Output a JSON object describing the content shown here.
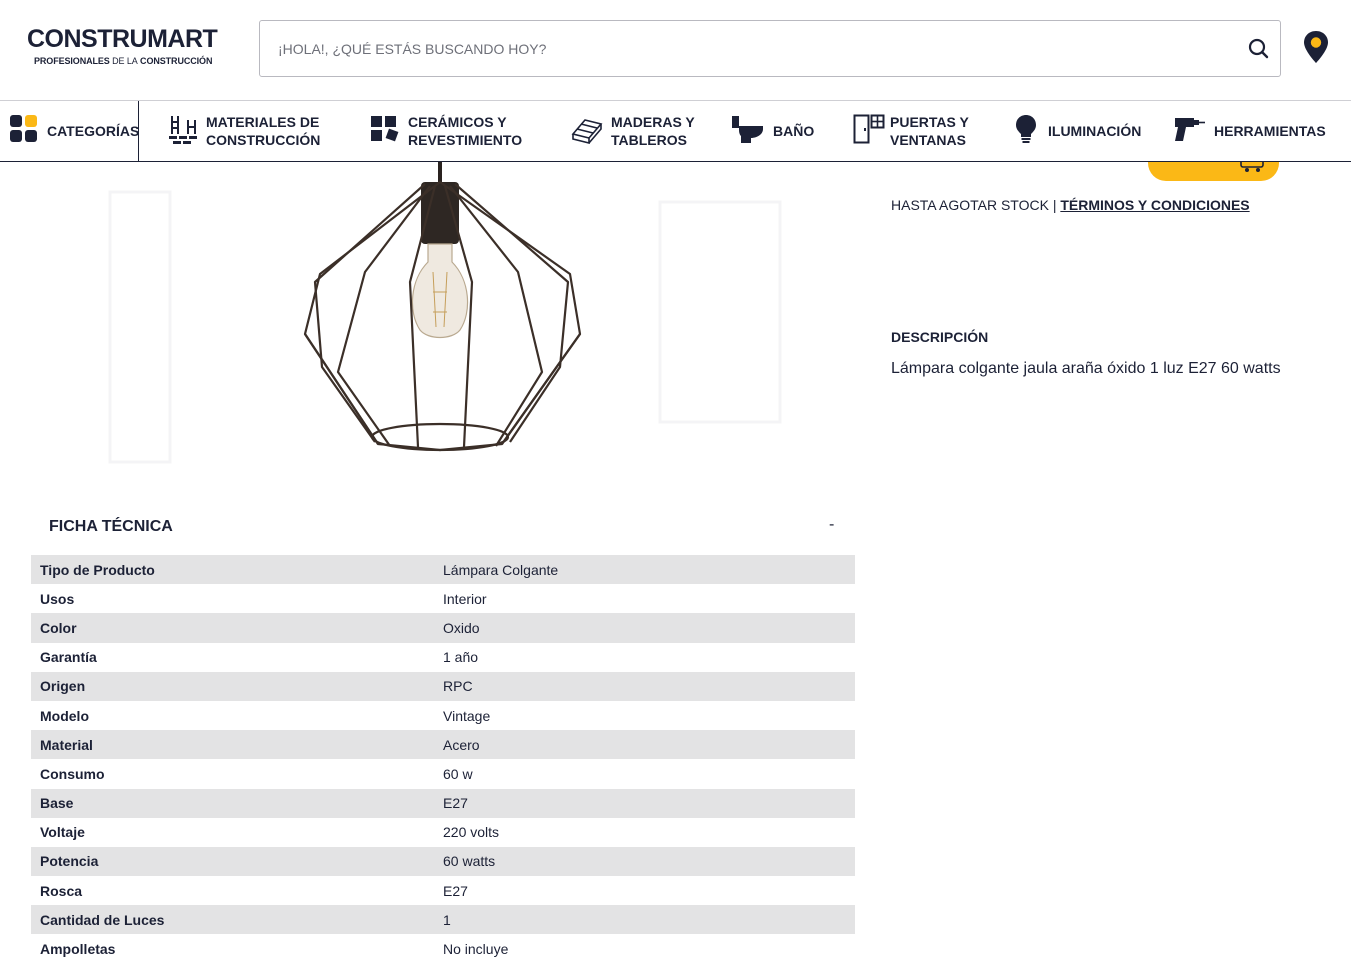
{
  "header": {
    "logo_main": "CONSTRUMART",
    "logo_sub_a": "PROFESIONALES",
    "logo_sub_b": "DE LA",
    "logo_sub_c": "CONSTRUCCIÓN",
    "search_placeholder": "¡HOLA!, ¿QUÉ ESTÁS BUSCANDO HOY?",
    "search_icon": "search-icon",
    "location_icon": "location-pin-icon"
  },
  "nav": {
    "items": [
      {
        "label": "CATEGORÍAS",
        "icon": "grid-icon"
      },
      {
        "label": "MATERIALES DE\nCONSTRUCCIÓN",
        "icon": "bricks-ladder-icon"
      },
      {
        "label": "CERÁMICOS Y\nREVESTIMIENTO",
        "icon": "tiles-icon"
      },
      {
        "label": "MADERAS Y\nTABLEROS",
        "icon": "wood-planks-icon"
      },
      {
        "label": "BAÑO",
        "icon": "toilet-icon"
      },
      {
        "label": "PUERTAS Y\nVENTANAS",
        "icon": "door-window-icon"
      },
      {
        "label": "ILUMINACIÓN",
        "icon": "lightbulb-icon"
      },
      {
        "label": "HERRAMIENTAS",
        "icon": "drill-icon"
      }
    ]
  },
  "promo": {
    "stock_text": "HASTA AGOTAR STOCK |",
    "terms_link": "TÉRMINOS Y CONDICIONES"
  },
  "description": {
    "title": "DESCRIPCIÓN",
    "text": "Lámpara colgante jaula araña óxido 1 luz E27 60 watts"
  },
  "spec": {
    "title": "FICHA TÉCNICA",
    "toggle": "-",
    "rows": [
      {
        "key": "Tipo de Producto",
        "value": "Lámpara Colgante"
      },
      {
        "key": "Usos",
        "value": "Interior"
      },
      {
        "key": "Color",
        "value": "Oxido"
      },
      {
        "key": "Garantía",
        "value": "1 año"
      },
      {
        "key": "Origen",
        "value": "RPC"
      },
      {
        "key": "Modelo",
        "value": "Vintage"
      },
      {
        "key": "Material",
        "value": "Acero"
      },
      {
        "key": "Consumo",
        "value": "60 w"
      },
      {
        "key": "Base",
        "value": "E27"
      },
      {
        "key": "Voltaje",
        "value": "220 volts"
      },
      {
        "key": "Potencia",
        "value": "60 watts"
      },
      {
        "key": "Rosca",
        "value": "E27"
      },
      {
        "key": "Cantidad de Luces",
        "value": "1"
      },
      {
        "key": "Ampolletas",
        "value": "No incluye"
      }
    ]
  },
  "colors": {
    "brand_navy": "#1c2136",
    "brand_yellow": "#fbb816",
    "row_alt": "#e3e3e4"
  }
}
